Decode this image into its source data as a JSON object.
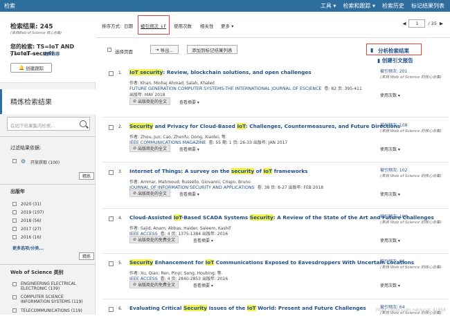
{
  "topbar": {
    "title": "检索",
    "menu": [
      "工具 ▾",
      "检索和跟踪 ▾",
      "检索历史",
      "标记结果列表"
    ]
  },
  "left": {
    "results_label": "检索结果: 245",
    "results_sub": "(来自Web of Science 核心合集)",
    "query_label": "您的检索: TS=IoT AND TI=IoT securit",
    "query_rest": "y NOT CF=2* ...",
    "more_content": "更多内容",
    "create_alert": "创建跟踪",
    "refine_title": "精炼检索结果",
    "search_placeholder": "在如下结果集内检索...",
    "filter_title": "过滤结果依据:",
    "open_access": "开放获取 (100)",
    "refine_btn": "精炼",
    "year_title": "出版年",
    "years": [
      "2020 (31)",
      "2019 (107)",
      "2018 (56)",
      "2017 (27)",
      "2016 (16)"
    ],
    "more_options": "更多选项/分类...",
    "wos_title": "Web of Science 类别",
    "cats": [
      "ENGINEERING ELECTRICAL ELECTRONIC (139)",
      "COMPUTER SCIENCE INFORMATION SYSTEMS (119)",
      "TELECOMMUNICATIONS (119)"
    ]
  },
  "sort": {
    "label": "排序方式:",
    "options": [
      "日期",
      "被引频次 ↓F",
      "使用次数",
      "相关性",
      "更多 ▾"
    ],
    "page": "1",
    "total": "/ 25"
  },
  "toolbar": {
    "select_page": "选择页面",
    "export": "导出...",
    "add_marked": "添加到标记结果列表",
    "analyze": "分析检索结果",
    "citation_report": "创建引文报告"
  },
  "records": [
    {
      "num": "1.",
      "title_parts": [
        "",
        "IoT security",
        ": Review, blockchain solutions, and open challenges"
      ],
      "authors": "作者: Khan, Minhaj Ahmad; Salah, Khaled",
      "journal": "FUTURE GENERATION COMPUTER SYSTEMS-THE INTERNATIONAL JOURNAL OF ESCIENCE",
      "jmeta": "卷: 82  页: 395-411",
      "date": "出版年: MAY 2018",
      "ft": "出版商处的全文",
      "view": "查看摘要 ▾",
      "cites": "被引频次: 201",
      "use": "使用次数 ▾"
    },
    {
      "num": "2.",
      "title_parts": [
        "",
        "Security",
        " and Privacy for Cloud-Based ",
        "IoT",
        ": Challenges, Countermeasures, and Future Directions"
      ],
      "authors": "作者: Zhou, Jun; Cao, Zhenfu; Dong, Xiaolei; 等.",
      "journal": "IEEE COMMUNICATIONS MAGAZINE",
      "jmeta": "卷: 55  期: 1  页: 26-33  出版年: JAN 2017",
      "ft": "出版商处的全文",
      "view": "查看摘要 ▾",
      "cites": "被引频次: 108",
      "use": "使用次数 ▾"
    },
    {
      "num": "3.",
      "title_parts": [
        "Internet of Things: A survey on the ",
        "security",
        " of ",
        "IoT",
        " frameworks"
      ],
      "authors": "作者: Ammar, Mahmoud; Russello, Giovanni; Crispo, Bruno",
      "journal": "JOURNAL OF INFORMATION SECURITY AND APPLICATIONS",
      "jmeta": "卷: 38  页: 8-27  出版年: FEB 2018",
      "ft": "出版商处的全文",
      "view": "查看摘要 ▾",
      "cites": "被引频次: 102",
      "use": "使用次数 ▾"
    },
    {
      "num": "4.",
      "title_parts": [
        "Cloud-Assisted ",
        "IoT",
        "-Based SCADA Systems ",
        "Security",
        ": A Review of the State of the Art and Future Challenges"
      ],
      "authors": "作者: Sajid, Anam; Abbas, Haider; Saleem, Kashif",
      "journal": "IEEE ACCESS",
      "jmeta": "卷: 4  页: 1375-1384  出版年: 2016",
      "ft": "出版商处的免费全文",
      "view": "查看摘要 ▾",
      "cites": "被引频次: 100",
      "use": "使用次数 ▾"
    },
    {
      "num": "5.",
      "title_parts": [
        "",
        "Security",
        " Enhancement for ",
        "IoT",
        " Communications Exposed to Eavesdroppers With Uncertain Locations"
      ],
      "authors": "作者: Xu, Qian; Ren, Pinyi; Song, Houbing; 等.",
      "journal": "IEEE ACCESS",
      "jmeta": "卷: 4  页: 2840-2853  出版年: 2016",
      "ft": "出版商处的免费全文",
      "view": "查看摘要 ▾",
      "cites": "被引频次: 86",
      "use": "使用次数 ▾"
    },
    {
      "num": "6.",
      "title_parts": [
        "Evaluating Critical ",
        "Security",
        " Issues of the ",
        "IoT",
        " World: Present and Future Challenges"
      ],
      "authors": "",
      "journal": "",
      "jmeta": "",
      "ft": "",
      "view": "",
      "cites": "被引频次: 64",
      "use": ""
    }
  ],
  "cite_source": "(来自 Web of Science 的核心合集)",
  "watermark": "https://blog.csdn.net/sinat_41858"
}
